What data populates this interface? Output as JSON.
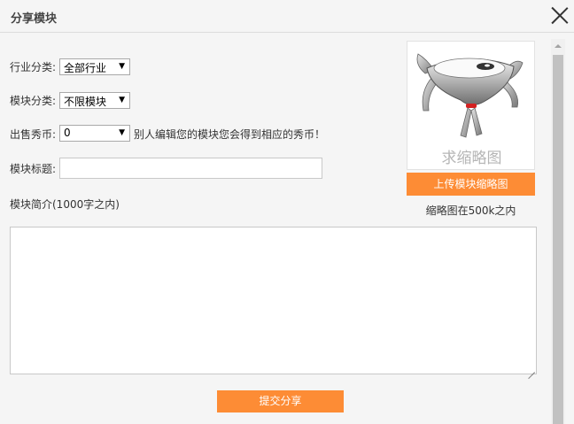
{
  "dialog": {
    "title": "分享模块"
  },
  "form": {
    "industry_label": "行业分类:",
    "industry_value": "全部行业",
    "module_type_label": "模块分类:",
    "module_type_value": "不限模块",
    "price_label": "出售秀币:",
    "price_value": "0",
    "price_hint": "别人编辑您的模块您会得到相应的秀币！",
    "title_label": "模块标题:",
    "title_value": "",
    "intro_label": "模块简介(1000字之内)",
    "intro_value": "",
    "submit_label": "提交分享"
  },
  "thumbnail": {
    "placeholder_text": "求缩略图",
    "upload_label": "上传模块缩略图",
    "size_note": "缩略图在500k之内"
  },
  "icons": {
    "close": "close-icon",
    "select_arrow": "triangle-down-icon",
    "mascot": "mascot-illustration"
  },
  "colors": {
    "accent": "#fd8c35",
    "background": "#f5f5f5"
  }
}
